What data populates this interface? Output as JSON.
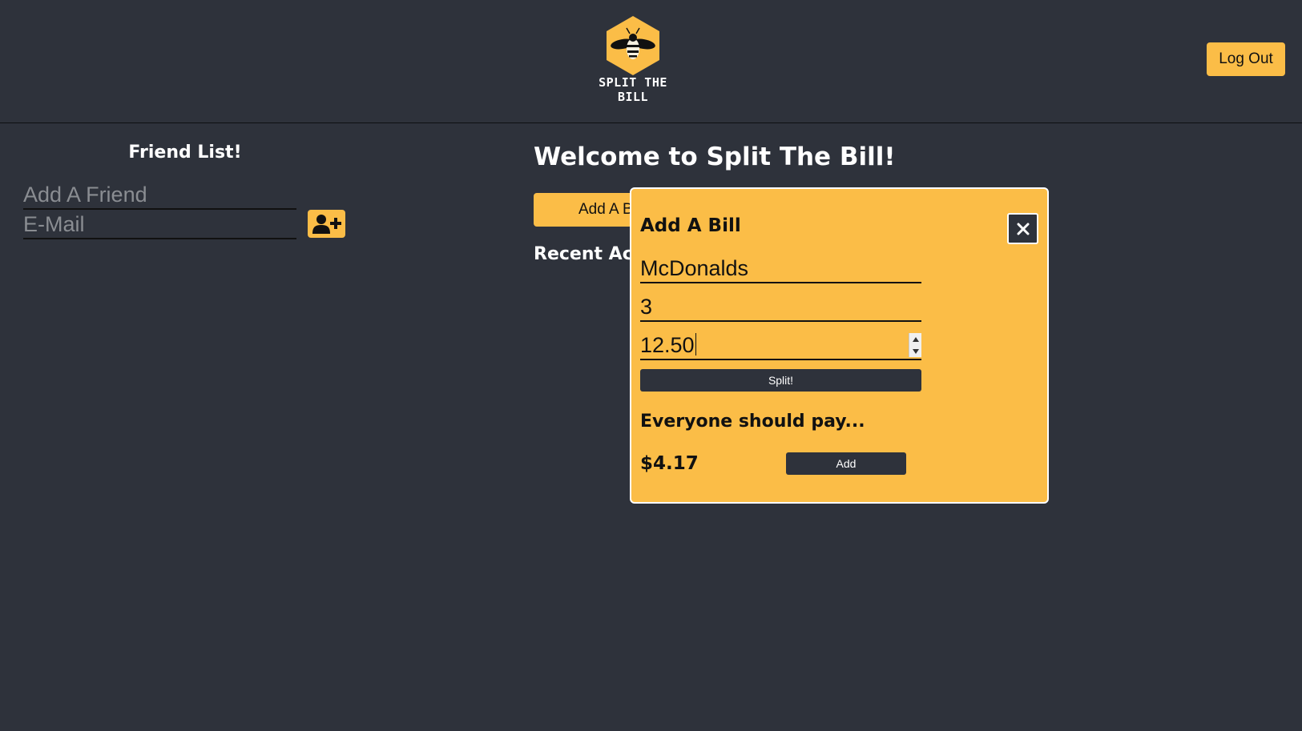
{
  "header": {
    "logo_text": "SPLIT THE BILL",
    "logout_label": "Log Out"
  },
  "friends": {
    "title": "Friend List!",
    "name_placeholder": "Add A Friend",
    "email_placeholder": "E-Mail",
    "add_icon": "user-plus-icon"
  },
  "main": {
    "welcome": "Welcome to Split The Bill!",
    "add_bill_label": "Add A Bill",
    "recent_activity": "Recent Activity"
  },
  "modal": {
    "title": "Add A Bill",
    "close_icon": "close-icon",
    "bill_name": "McDonalds",
    "people_count": "3",
    "amount": "12.50",
    "split_label": "Split!",
    "result_heading": "Everyone should pay...",
    "result_amount": "$4.17",
    "add_label": "Add"
  },
  "colors": {
    "background": "#2e323b",
    "accent": "#fbbd47",
    "text_light": "#ffffff",
    "text_dark": "#111111"
  }
}
